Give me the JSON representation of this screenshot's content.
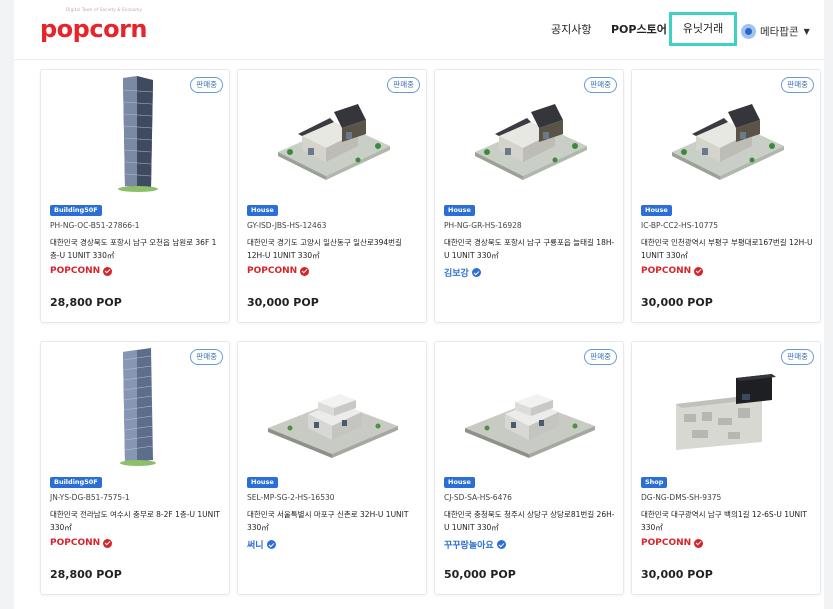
{
  "header": {
    "logo_tagline": "Digital Town of Society & Economy",
    "logo_text": "popcorn",
    "nav": {
      "notice": "공지사항",
      "store": "POP스토어",
      "trade": "유닛거래"
    },
    "user": {
      "name": "메타팝콘"
    }
  },
  "colors": {
    "brand": "#e8242b",
    "accent_blue": "#2b6fd6",
    "nav_highlight": "#3fd1c3"
  },
  "cards": [
    {
      "status": "판매중",
      "has_status": true,
      "type": "Building50F",
      "thumb": "tower",
      "code": "PH-NG-OC-B51-27866-1",
      "address": "대한민국 경상북도 포항시 남구 오천읍 남원로 36F 1층-U 1UNIT 330㎡",
      "seller": "POPCONN",
      "seller_color": "#d8232a",
      "verified_color": "#d8232a",
      "price": "28,800 POP"
    },
    {
      "status": "판매중",
      "has_status": true,
      "type": "House",
      "thumb": "house",
      "code": "GY-ISD-JBS-HS-12463",
      "address": "대한민국 경기도 고양시 일산동구 일산로394번길 12H-U 1UNIT 330㎡",
      "seller": "POPCONN",
      "seller_color": "#d8232a",
      "verified_color": "#d8232a",
      "price": "30,000 POP"
    },
    {
      "status": "판매중",
      "has_status": true,
      "type": "House",
      "thumb": "house",
      "code": "PH-NG-GR-HS-16928",
      "address": "대한민국 경상북도 포항시 남구 구룡포읍 늘태길 18H-U 1UNIT 330㎡",
      "seller": "김보강",
      "seller_color": "#2b6fd6",
      "verified_color": "#2b6fd6",
      "price": ""
    },
    {
      "status": "판매중",
      "has_status": true,
      "type": "House",
      "thumb": "house",
      "code": "IC-BP-CC2-HS-10775",
      "address": "대한민국 인천광역시 부평구 부평대로167번길 12H-U 1UNIT 330㎡",
      "seller": "POPCONN",
      "seller_color": "#d8232a",
      "verified_color": "#d8232a",
      "price": "30,000 POP"
    },
    {
      "status": "판매중",
      "has_status": true,
      "type": "Building50F",
      "thumb": "tower2",
      "code": "JN-YS-DG-B51-7575-1",
      "address": "대한민국 전라남도 여수시 충무로 8-2F 1층-U 1UNIT 330㎡",
      "seller": "POPCONN",
      "seller_color": "#d8232a",
      "verified_color": "#d8232a",
      "price": "28,800 POP"
    },
    {
      "status": "",
      "has_status": false,
      "type": "House",
      "thumb": "villa",
      "code": "SEL-MP-SG-2-HS-16530",
      "address": "대한민국 서울특별시 마포구 신촌로 32H-U 1UNIT 330㎡",
      "seller": "써니",
      "seller_color": "#2b6fd6",
      "verified_color": "#2b6fd6",
      "price": ""
    },
    {
      "status": "판매중",
      "has_status": true,
      "type": "House",
      "thumb": "villa",
      "code": "CJ-SD-SA-HS-6476",
      "address": "대한민국 충청북도 청주시 상당구 상당로81번길 26H-U 1UNIT 330㎡",
      "seller": "꾸꾸랑놀아요",
      "seller_color": "#2b6fd6",
      "verified_color": "#2b6fd6",
      "price": "50,000 POP"
    },
    {
      "status": "판매중",
      "has_status": true,
      "type": "Shop",
      "thumb": "shop",
      "code": "DG-NG-DMS-SH-9375",
      "address": "대한민국 대구광역시 남구 백의1길 12-6S-U 1UNIT 330㎡",
      "seller": "POPCONN",
      "seller_color": "#d8232a",
      "verified_color": "#d8232a",
      "price": "30,000 POP"
    }
  ]
}
